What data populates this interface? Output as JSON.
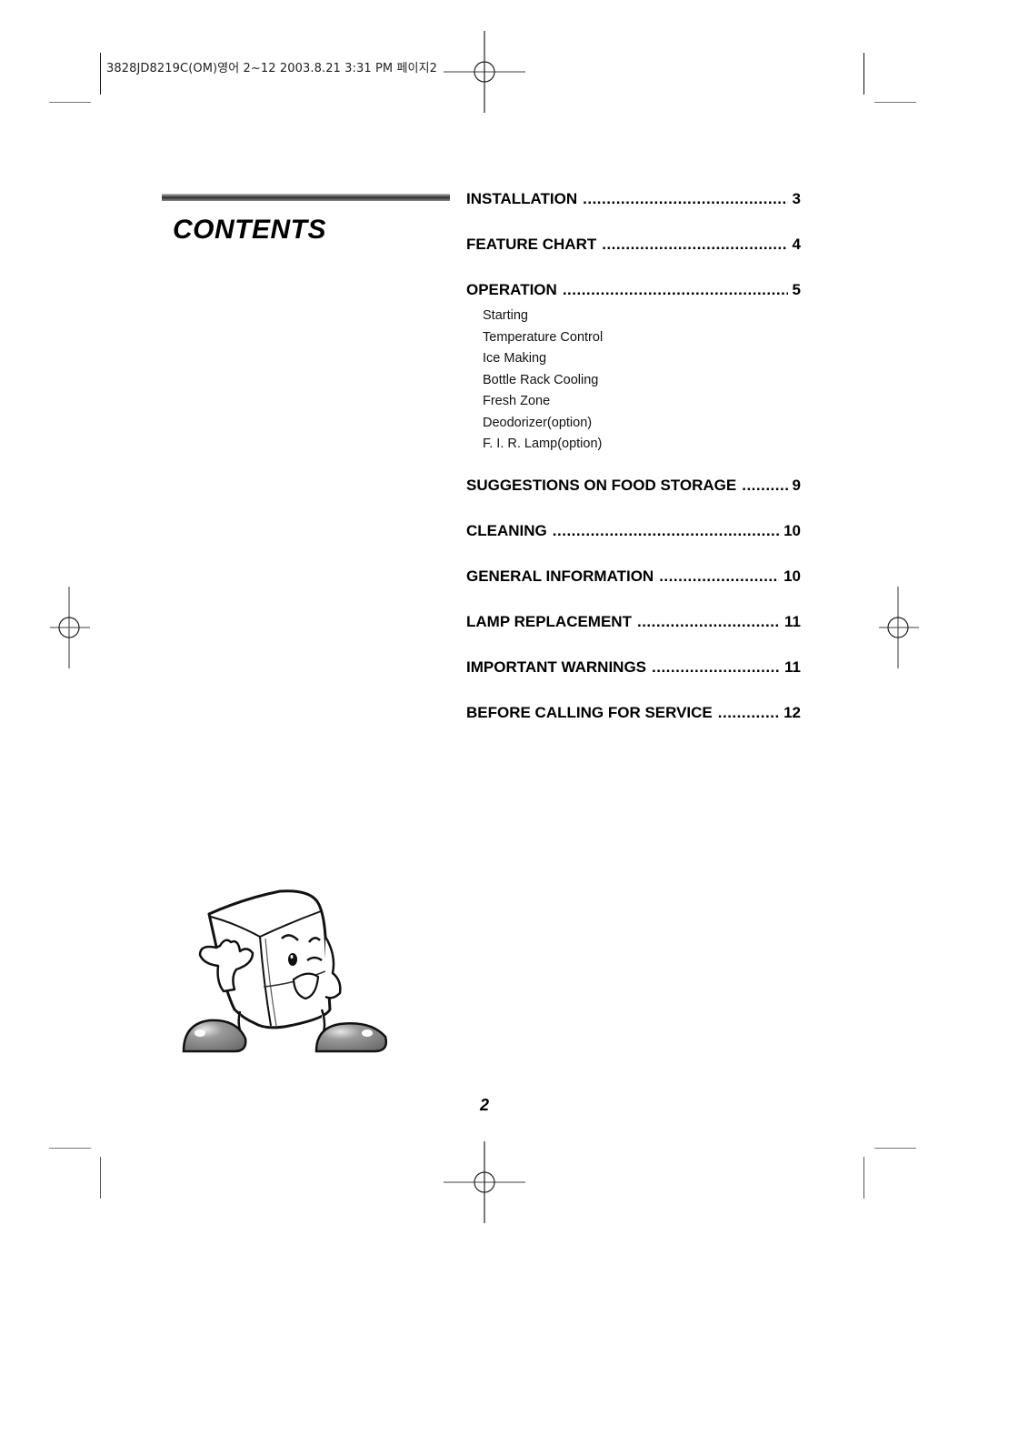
{
  "print_slug": "3828JD8219C(OM)영어 2~12  2003.8.21 3:31 PM 페이지2",
  "header": {
    "title": "CONTENTS"
  },
  "toc": [
    {
      "label": "INSTALLATION",
      "page": "3",
      "subitems": []
    },
    {
      "label": "FEATURE CHART",
      "page": "4",
      "subitems": []
    },
    {
      "label": "OPERATION",
      "page": "5",
      "subitems": [
        "Starting",
        "Temperature Control",
        "Ice Making",
        "Bottle Rack Cooling",
        "Fresh Zone",
        "Deodorizer(option)",
        "F. I. R. Lamp(option)"
      ]
    },
    {
      "label": "SUGGESTIONS ON FOOD STORAGE",
      "page": "9",
      "subitems": []
    },
    {
      "label": "CLEANING",
      "page": "10",
      "subitems": []
    },
    {
      "label": "GENERAL INFORMATION",
      "page": "10",
      "subitems": []
    },
    {
      "label": "LAMP REPLACEMENT",
      "page": "11",
      "subitems": []
    },
    {
      "label": "IMPORTANT WARNINGS",
      "page": "11",
      "subitems": []
    },
    {
      "label": "BEFORE CALLING FOR SERVICE",
      "page": "12",
      "subitems": []
    }
  ],
  "illustration": {
    "icon": "refrigerator-mascot-icon",
    "description": "Winking refrigerator mascot character"
  },
  "footer": {
    "page_number": "2"
  }
}
